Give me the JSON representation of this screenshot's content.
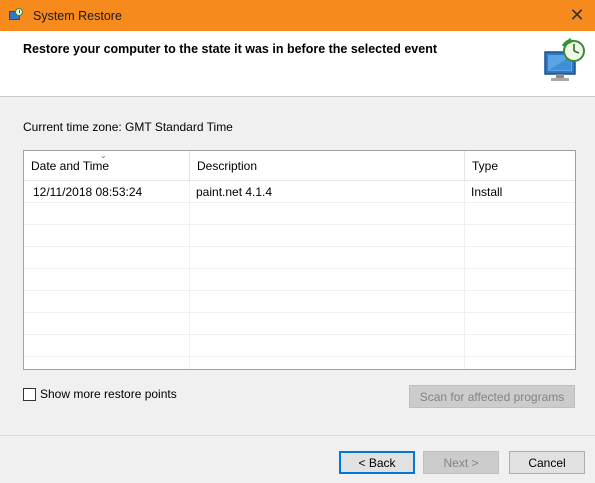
{
  "window": {
    "title": "System Restore",
    "close_label": "✕"
  },
  "header": {
    "title": "Restore your computer to the state it was in before the selected event"
  },
  "timezone": {
    "label": "Current time zone: GMT Standard Time"
  },
  "list": {
    "columns": [
      {
        "label": "Date and Time"
      },
      {
        "label": "Description"
      },
      {
        "label": "Type"
      }
    ],
    "sort_indicator": "⌄",
    "rows": [
      {
        "date": "12/11/2018 08:53:24",
        "description": "paint.net 4.1.4",
        "type": "Install"
      }
    ]
  },
  "options": {
    "show_more_label": "Show more restore points",
    "show_more_checked": false
  },
  "buttons": {
    "scan_label": "Scan for affected programs",
    "back_label": "< Back",
    "next_label": "Next >",
    "cancel_label": "Cancel"
  },
  "colors": {
    "titlebar": "#f78a1d",
    "accent": "#0078d7"
  }
}
